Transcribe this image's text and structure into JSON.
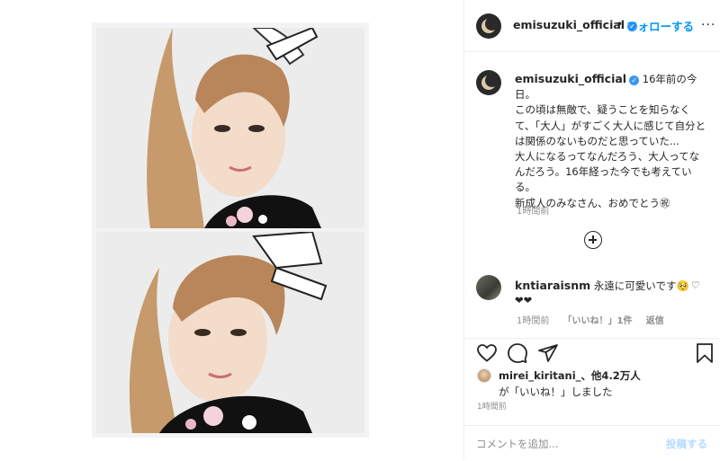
{
  "header": {
    "username": "emisuzuki_official",
    "verified_icon": "verified-badge-icon",
    "separator": "•",
    "follow_label": "フォローする",
    "more_icon": "more-options-icon"
  },
  "caption": {
    "username": "emisuzuki_official",
    "text_lines": [
      "16年前の今日。",
      "この頃は無敵で、疑うことを知らなくて、「大人」がすごく大人に感じて自分とは関係のないものだと思っていた...",
      "大人になるってなんだろう、大人ってなんだろう。16年経った今でも考えている。",
      "新成人のみなさん、おめでとう㊗"
    ],
    "time": "1時間前"
  },
  "load_more_icon": "plus-circle-icon",
  "comment": {
    "username": "kntiaraisnm",
    "text": "永遠に可愛いです🥺❤❤",
    "time": "1時間前",
    "likes": "「いいね！」1件",
    "reply": "返信"
  },
  "likes": {
    "user": "mirei_kiritani_",
    "others": "、他4.2万人",
    "suffix": "が「いいね！」しました"
  },
  "post_time": "1時間前",
  "add_comment": {
    "placeholder": "コメントを追加...",
    "post_label": "投稿する"
  },
  "colors": {
    "accent": "#0095f6",
    "verified": "#3897f0",
    "muted": "#8e8e8e",
    "post_disabled": "#b3dbff"
  }
}
